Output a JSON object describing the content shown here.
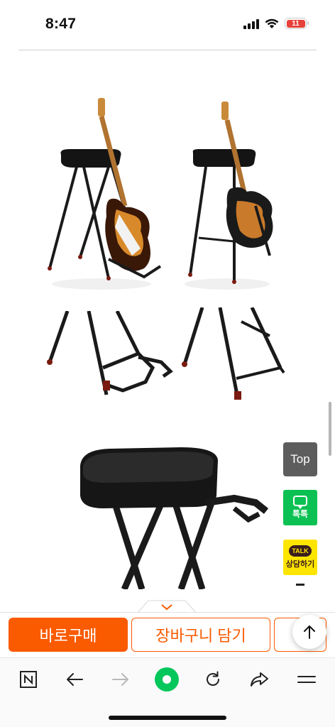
{
  "status_bar": {
    "time": "8:47",
    "battery_level": "11",
    "battery_color": "#e8413b"
  },
  "product_images": [
    {
      "name": "stool-with-guitar-front-angle"
    },
    {
      "name": "stool-with-guitar-side"
    },
    {
      "name": "guitar-holder-closeup-left"
    },
    {
      "name": "guitar-holder-closeup-right"
    },
    {
      "name": "stool-seat-closeup"
    }
  ],
  "side_buttons": {
    "top_label": "Top",
    "talktalk_label": "톡톡",
    "talktalk_color": "#0cc153",
    "kakao_badge": "TALK",
    "kakao_label": "상담하기",
    "kakao_color": "#fee500"
  },
  "purchase_bar": {
    "buy_now_label": "바로구매",
    "cart_label": "장바구니 담기",
    "accent_color": "#fa5a00"
  },
  "browser_nav": {
    "items": [
      "naver-n-icon",
      "back-arrow-icon",
      "forward-arrow-icon",
      "home-dot-icon",
      "refresh-icon",
      "share-icon",
      "menu-icon"
    ]
  }
}
